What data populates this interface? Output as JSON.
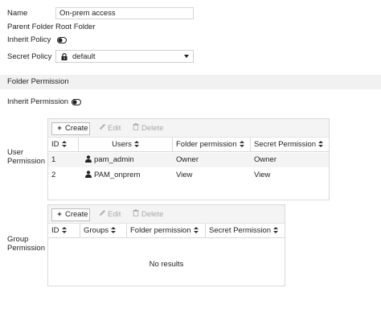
{
  "form": {
    "name_label": "Name",
    "name_value": "On-prem access",
    "parent_folder_label": "Parent Folder",
    "parent_folder_value": "Root Folder",
    "inherit_policy_label": "Inherit Policy",
    "inherit_policy_on": false,
    "secret_policy_label": "Secret Policy",
    "secret_policy_value": "default"
  },
  "folder_permission": {
    "section_title": "Folder Permission",
    "inherit_permission_label": "Inherit Permission",
    "inherit_permission_on": false
  },
  "user_permission": {
    "label_line1": "User",
    "label_line2": "Permission",
    "toolbar": {
      "create": "Create",
      "edit": "Edit",
      "delete": "Delete"
    },
    "columns": [
      "ID",
      "Users",
      "Folder permission",
      "Secret Permission"
    ],
    "rows": [
      {
        "id": "1",
        "user": "pam_admin",
        "folder_permission": "Owner",
        "secret_permission": "Owner"
      },
      {
        "id": "2",
        "user": "PAM_onprem",
        "folder_permission": "View",
        "secret_permission": "View"
      }
    ]
  },
  "group_permission": {
    "label_line1": "Group",
    "label_line2": "Permission",
    "toolbar": {
      "create": "Create",
      "edit": "Edit",
      "delete": "Delete"
    },
    "columns": [
      "ID",
      "Groups",
      "Folder permission",
      "Secret Permission"
    ],
    "empty_text": "No results"
  },
  "icons": {
    "plus": "plus-icon",
    "pencil": "pencil-icon",
    "trash": "trash-icon",
    "user": "user-icon",
    "lock": "lock-icon",
    "sort": "sort-icon",
    "toggle": "toggle-off-icon",
    "caret": "caret-down-icon"
  }
}
